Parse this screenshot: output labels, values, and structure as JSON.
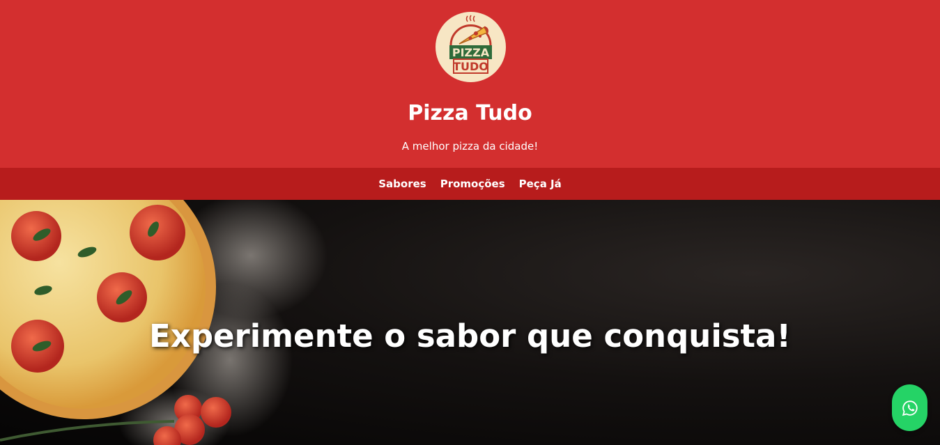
{
  "header": {
    "logo_text_top": "PIZZA",
    "logo_text_bottom": "TUDO",
    "title": "Pizza Tudo",
    "tagline": "A melhor pizza da cidade!"
  },
  "nav": {
    "items": [
      {
        "label": "Sabores"
      },
      {
        "label": "Promoções"
      },
      {
        "label": "Peça Já"
      }
    ]
  },
  "hero": {
    "headline": "Experimente o sabor que conquista!"
  },
  "whatsapp": {
    "icon": "whatsapp-icon"
  },
  "colors": {
    "header_red": "#d32f2f",
    "nav_red": "#b71c1c",
    "whatsapp_green": "#25d366",
    "logo_cream": "#f7e6c4",
    "logo_green": "#2e6b3a"
  }
}
